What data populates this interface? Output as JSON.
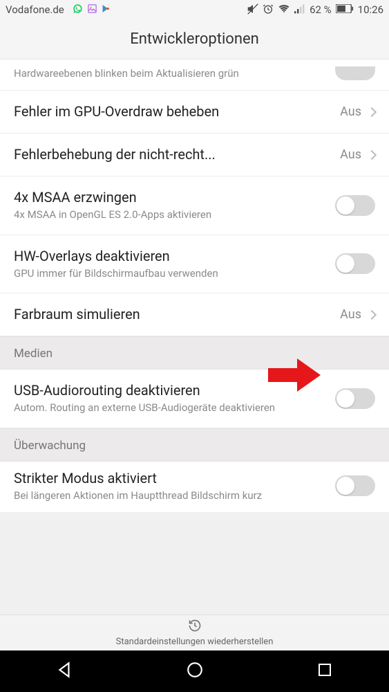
{
  "statusbar": {
    "carrier": "Vodafone.de",
    "battery": "62 %",
    "time": "10:26"
  },
  "title": "Entwickleroptionen",
  "rows": {
    "partial_top_sub": "Hardwareebenen blinken beim Aktualisieren grün",
    "gpu_overdraw": {
      "title": "Fehler im GPU-Overdraw beheben",
      "value": "Aus"
    },
    "nonrect_clip": {
      "title": "Fehlerbehebung der nicht-recht...",
      "value": "Aus"
    },
    "msaa": {
      "title": "4x MSAA erzwingen",
      "sub": "4x MSAA in OpenGL ES 2.0-Apps aktivieren"
    },
    "hw_overlays": {
      "title": "HW-Overlays deaktivieren",
      "sub": "GPU immer für Bildschirmaufbau verwenden"
    },
    "color_space": {
      "title": "Farbraum simulieren",
      "value": "Aus"
    },
    "usb_audio": {
      "title": "USB-Audiorouting deaktivieren",
      "sub": "Autom. Routing an externe USB-Audiogeräte deaktivieren"
    },
    "strict_mode": {
      "title": "Strikter Modus aktiviert",
      "sub": "Bei längeren Aktionen im Hauptthread Bildschirm kurz"
    }
  },
  "sections": {
    "media": "Medien",
    "monitoring": "Überwachung"
  },
  "restore": "Standardeinstellungen wiederherstellen"
}
